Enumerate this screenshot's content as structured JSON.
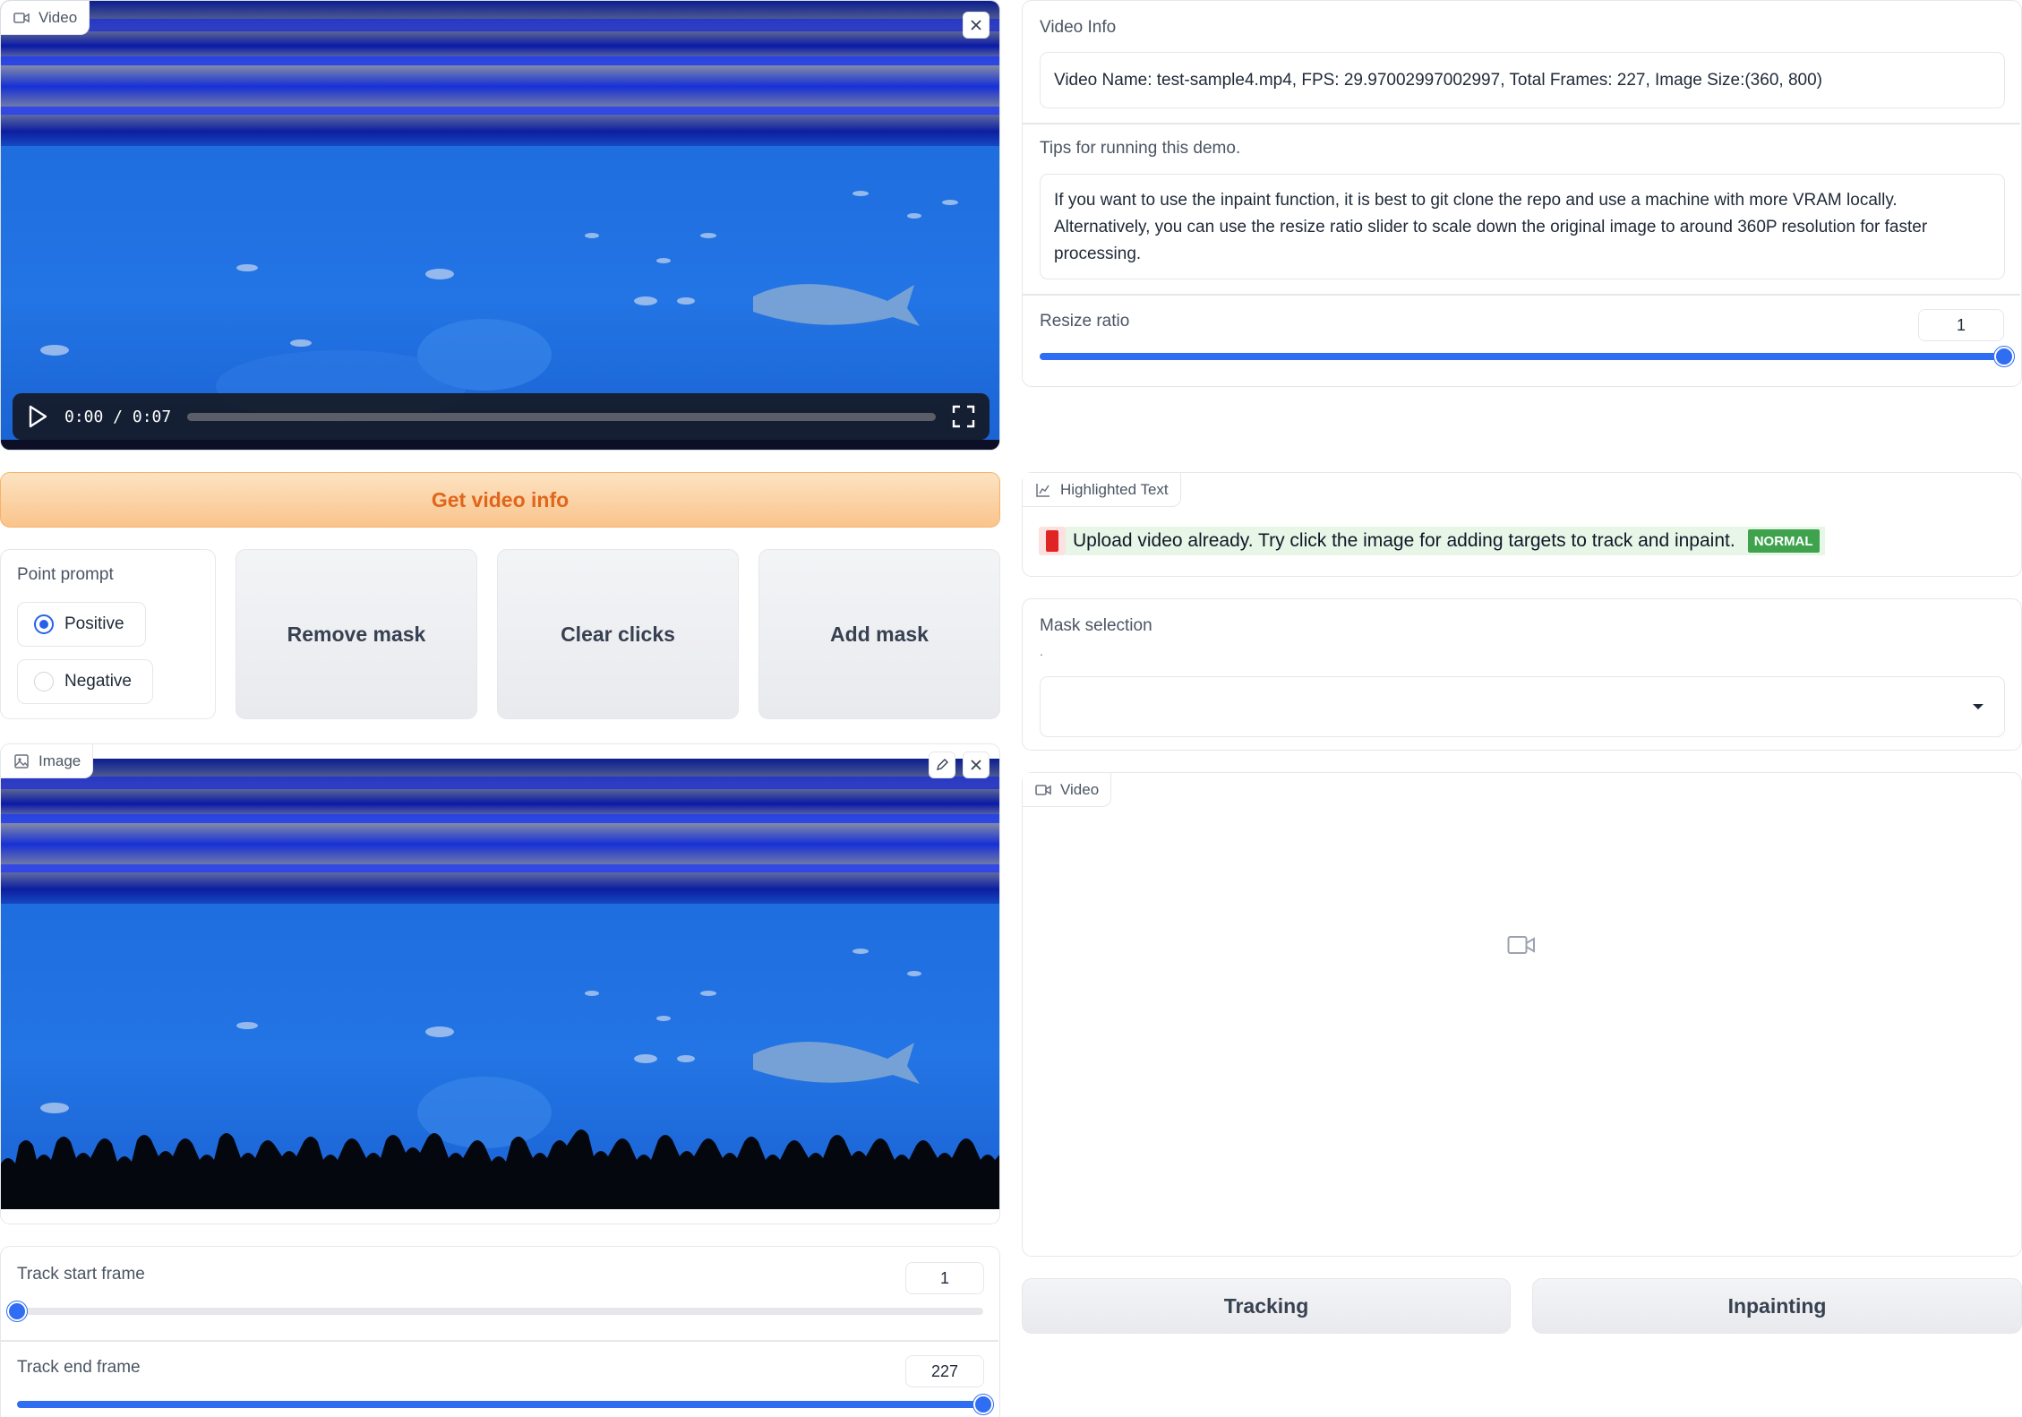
{
  "video_input": {
    "tag_label": "Video",
    "time_display": "0:00 / 0:07"
  },
  "get_info_button": {
    "label": "Get video info"
  },
  "video_info": {
    "label": "Video Info",
    "value": "Video Name: test-sample4.mp4, FPS: 29.97002997002997, Total Frames: 227, Image Size:(360, 800)"
  },
  "tips": {
    "label": "Tips for running this demo.",
    "value": "If you want to use the inpaint function, it is best to git clone the repo and use a machine with more VRAM locally. Alternatively, you can use the resize ratio slider to scale down the original image to around 360P resolution for faster processing."
  },
  "resize_ratio": {
    "label": "Resize ratio",
    "value": "1",
    "fraction": 1.0
  },
  "point_prompt": {
    "label": "Point prompt",
    "options": [
      {
        "label": "Positive",
        "selected": true
      },
      {
        "label": "Negative",
        "selected": false
      }
    ]
  },
  "mask_buttons": {
    "remove": "Remove mask",
    "clear": "Clear clicks",
    "add": "Add mask"
  },
  "highlighted": {
    "tag_label": "Highlighted Text",
    "message": "Upload video already. Try click the image for adding targets to track and inpaint.",
    "badge": "NORMAL"
  },
  "mask_selection": {
    "label": "Mask selection",
    "info": ".",
    "value": ""
  },
  "image_panel": {
    "tag_label": "Image"
  },
  "video_output": {
    "tag_label": "Video"
  },
  "track_start": {
    "label": "Track start frame",
    "value": "1",
    "fraction": 0.0
  },
  "track_end": {
    "label": "Track end frame",
    "value": "227",
    "fraction": 1.0
  },
  "action_buttons": {
    "tracking": "Tracking",
    "inpainting": "Inpainting"
  },
  "colors": {
    "accent_blue": "#2f6df3",
    "primary_orange": "#e0661c",
    "status_green": "#3fa34d",
    "status_red": "#e02424"
  },
  "icons": [
    "video-icon",
    "close-icon",
    "play-icon",
    "fullscreen-icon",
    "image-icon",
    "edit-icon",
    "chart-icon",
    "dropdown-caret-icon",
    "video-placeholder-icon"
  ]
}
